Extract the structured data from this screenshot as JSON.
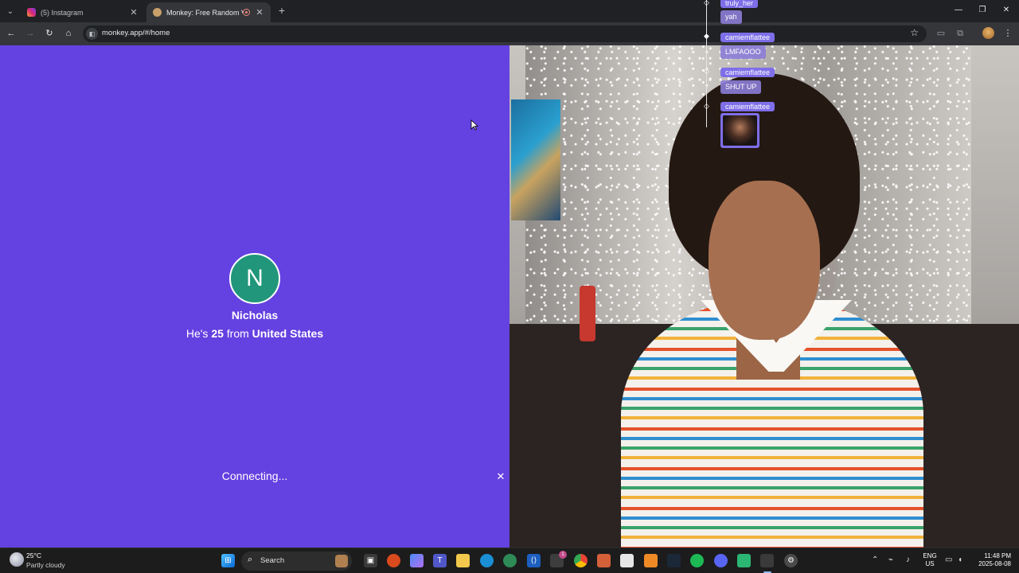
{
  "browser": {
    "tabs": [
      {
        "title": "(5) Instagram",
        "active": false
      },
      {
        "title": "Monkey: Free Random Vide",
        "active": true
      }
    ],
    "url": "monkey.app/#/home"
  },
  "profile": {
    "initial": "N",
    "name": "Nicholas",
    "pronoun": "He's",
    "age": "25",
    "from_word": "from",
    "country": "United States"
  },
  "status": {
    "text": "Connecting..."
  },
  "chat": [
    {
      "user": "truly_her",
      "message": "yah"
    },
    {
      "user": "camiemflattee",
      "message": "LMFAOOO"
    },
    {
      "user": "camiemflattee",
      "message": "SHUT UP"
    },
    {
      "user": "camiemflattee",
      "message": ""
    }
  ],
  "taskbar": {
    "weather_temp": "25°C",
    "weather_condition": "Partly cloudy",
    "search_label": "Search",
    "lang_top": "ENG",
    "lang_bottom": "US",
    "time": "11:48 PM",
    "date": "2025-08-08",
    "badge_count": "1"
  },
  "colors": {
    "panel_bg": "#6441e1",
    "avatar_bg": "#21967a",
    "chat_user_bg": "#7e6ee8"
  }
}
